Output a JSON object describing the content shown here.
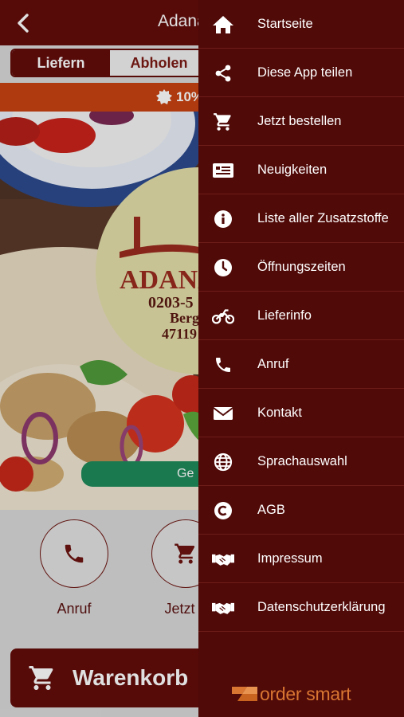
{
  "header": {
    "title": "Adana",
    "back_icon": "chevron-left-icon"
  },
  "order_mode": {
    "options": [
      "Liefern",
      "Abholen"
    ],
    "selected": "Liefern"
  },
  "promo": {
    "icon": "badge-icon",
    "text": "10%"
  },
  "hero": {
    "restaurant_name": "ADANA",
    "phone_partial": "0203-5",
    "street_partial": "Berg",
    "zip_partial": "47119",
    "cta_partial": "Ge"
  },
  "actions": [
    {
      "label": "Anruf",
      "icon": "phone-icon"
    },
    {
      "label": "Jetzt b",
      "icon": "cart-icon"
    }
  ],
  "cart": {
    "label": "Warenkorb",
    "icon": "cart-icon"
  },
  "drawer": {
    "items": [
      {
        "label": "Startseite",
        "icon": "home-icon"
      },
      {
        "label": "Diese App teilen",
        "icon": "share-icon"
      },
      {
        "label": "Jetzt bestellen",
        "icon": "cart-icon"
      },
      {
        "label": "Neuigkeiten",
        "icon": "news-icon"
      },
      {
        "label": "Liste aller Zusatzstoffe",
        "icon": "info-icon"
      },
      {
        "label": "Öffnungszeiten",
        "icon": "clock-icon"
      },
      {
        "label": "Lieferinfo",
        "icon": "motorcycle-icon"
      },
      {
        "label": "Anruf",
        "icon": "phone-icon"
      },
      {
        "label": "Kontakt",
        "icon": "envelope-icon"
      },
      {
        "label": "Sprachauswahl",
        "icon": "globe-icon"
      },
      {
        "label": "AGB",
        "icon": "copyright-icon"
      },
      {
        "label": "Impressum",
        "icon": "handshake-icon"
      },
      {
        "label": "Datenschutzerklärung",
        "icon": "handshake-icon"
      }
    ],
    "brand": "order smart"
  },
  "colors": {
    "primary": "#620d0b",
    "drawer_bg": "#500a08",
    "promo": "#c84312",
    "cta_green": "#1f8a5c",
    "brand_orange": "#d97632"
  }
}
